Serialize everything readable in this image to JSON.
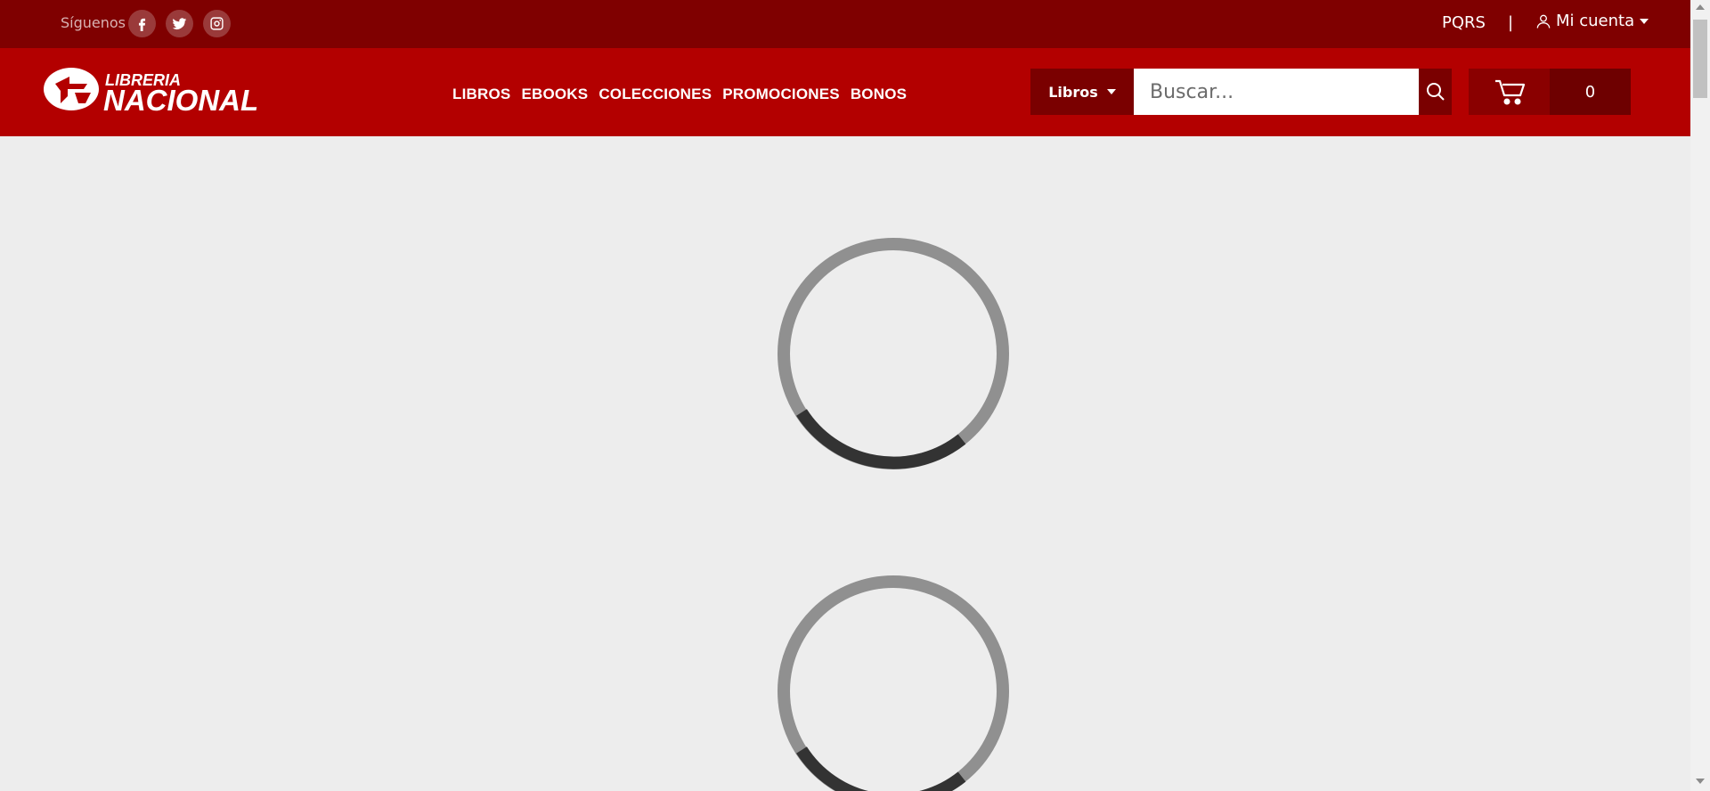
{
  "topbar": {
    "follow_label": "Síguenos",
    "social": [
      {
        "icon": "facebook-icon"
      },
      {
        "icon": "twitter-icon"
      },
      {
        "icon": "instagram-icon"
      }
    ],
    "pqrs_label": "PQRS",
    "separator": "|",
    "account_label": "Mi cuenta"
  },
  "header": {
    "logo_line1": "LIBRERIA",
    "logo_line2": "NACIONAL",
    "nav": [
      "LIBROS",
      "EBOOKS",
      "COLECCIONES",
      "PROMOCIONES",
      "BONOS"
    ],
    "category_label": "Libros",
    "search_placeholder": "Buscar...",
    "cart_count": "0"
  },
  "colors": {
    "topbar": "#7f0000",
    "header": "#b30000",
    "dark_button": "#7a0000",
    "background": "#ededed"
  }
}
